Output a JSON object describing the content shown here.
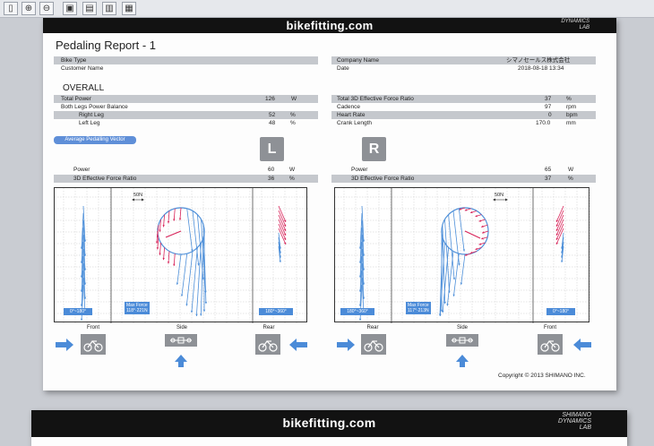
{
  "header": {
    "logo": "bikefitting.com",
    "brand_line1": "SHIMANO",
    "brand_line2": "DYNAMICS",
    "brand_line3": "LAB"
  },
  "report": {
    "title": "Pedaling Report - 1"
  },
  "info": {
    "bike_type": "Bike Type",
    "customer_name": "Customer Name",
    "company_name": "Company Name",
    "company_value": "シマノセールス株式会社",
    "date": "Date",
    "date_value": "2018-08-18 13:34"
  },
  "overall": {
    "heading": "OVERALL",
    "left_rows": [
      {
        "label": "Total Power",
        "value": "126",
        "unit": "W"
      },
      {
        "label": "Both Legs Power Balance",
        "value": "",
        "unit": ""
      },
      {
        "label": "Right Leg",
        "value": "52",
        "unit": "%"
      },
      {
        "label": "Left Leg",
        "value": "48",
        "unit": "%"
      }
    ],
    "right_rows": [
      {
        "label": "Total 3D Effective Force Ratio",
        "value": "37",
        "unit": "%"
      },
      {
        "label": "Cadence",
        "value": "97",
        "unit": "rpm"
      },
      {
        "label": "Heart Rate",
        "value": "0",
        "unit": "bpm"
      },
      {
        "label": "Crank Length",
        "value": "170.0",
        "unit": "mm"
      }
    ]
  },
  "vector_button": "Average Pedalling Vector",
  "left_leg": {
    "tag": "L",
    "power_label": "Power",
    "power": "60",
    "power_unit": "W",
    "ratio_label": "3D Effective Force Ratio",
    "ratio": "36",
    "ratio_unit": "%",
    "front_range": "0°~180°",
    "rear_range": "180°~360°",
    "max_force": "Max Force",
    "max_force_value": "118°·221N",
    "scale": "50N"
  },
  "right_leg": {
    "tag": "R",
    "power_label": "Power",
    "power": "65",
    "power_unit": "W",
    "ratio_label": "3D Effective Force Ratio",
    "ratio": "37",
    "ratio_unit": "%",
    "front_range": "180°~360°",
    "rear_range": "0°~180°",
    "max_force": "Max Force",
    "max_force_value": "117°·213N",
    "scale": "50N"
  },
  "views": {
    "front": "Front",
    "side": "Side",
    "rear": "Rear"
  },
  "copyright": "Copyright © 2013 SHIMANO INC.",
  "colors": {
    "accent": "#4b8bd8",
    "vector_blue": "#4d8fd9",
    "vector_red": "#d8245a",
    "header_bg": "#121212"
  },
  "toolbar_icons": [
    "page-icon",
    "zoom-in-icon",
    "zoom-out-icon",
    "fit-page-icon",
    "fit-width-icon",
    "single-page-icon",
    "two-page-icon"
  ]
}
